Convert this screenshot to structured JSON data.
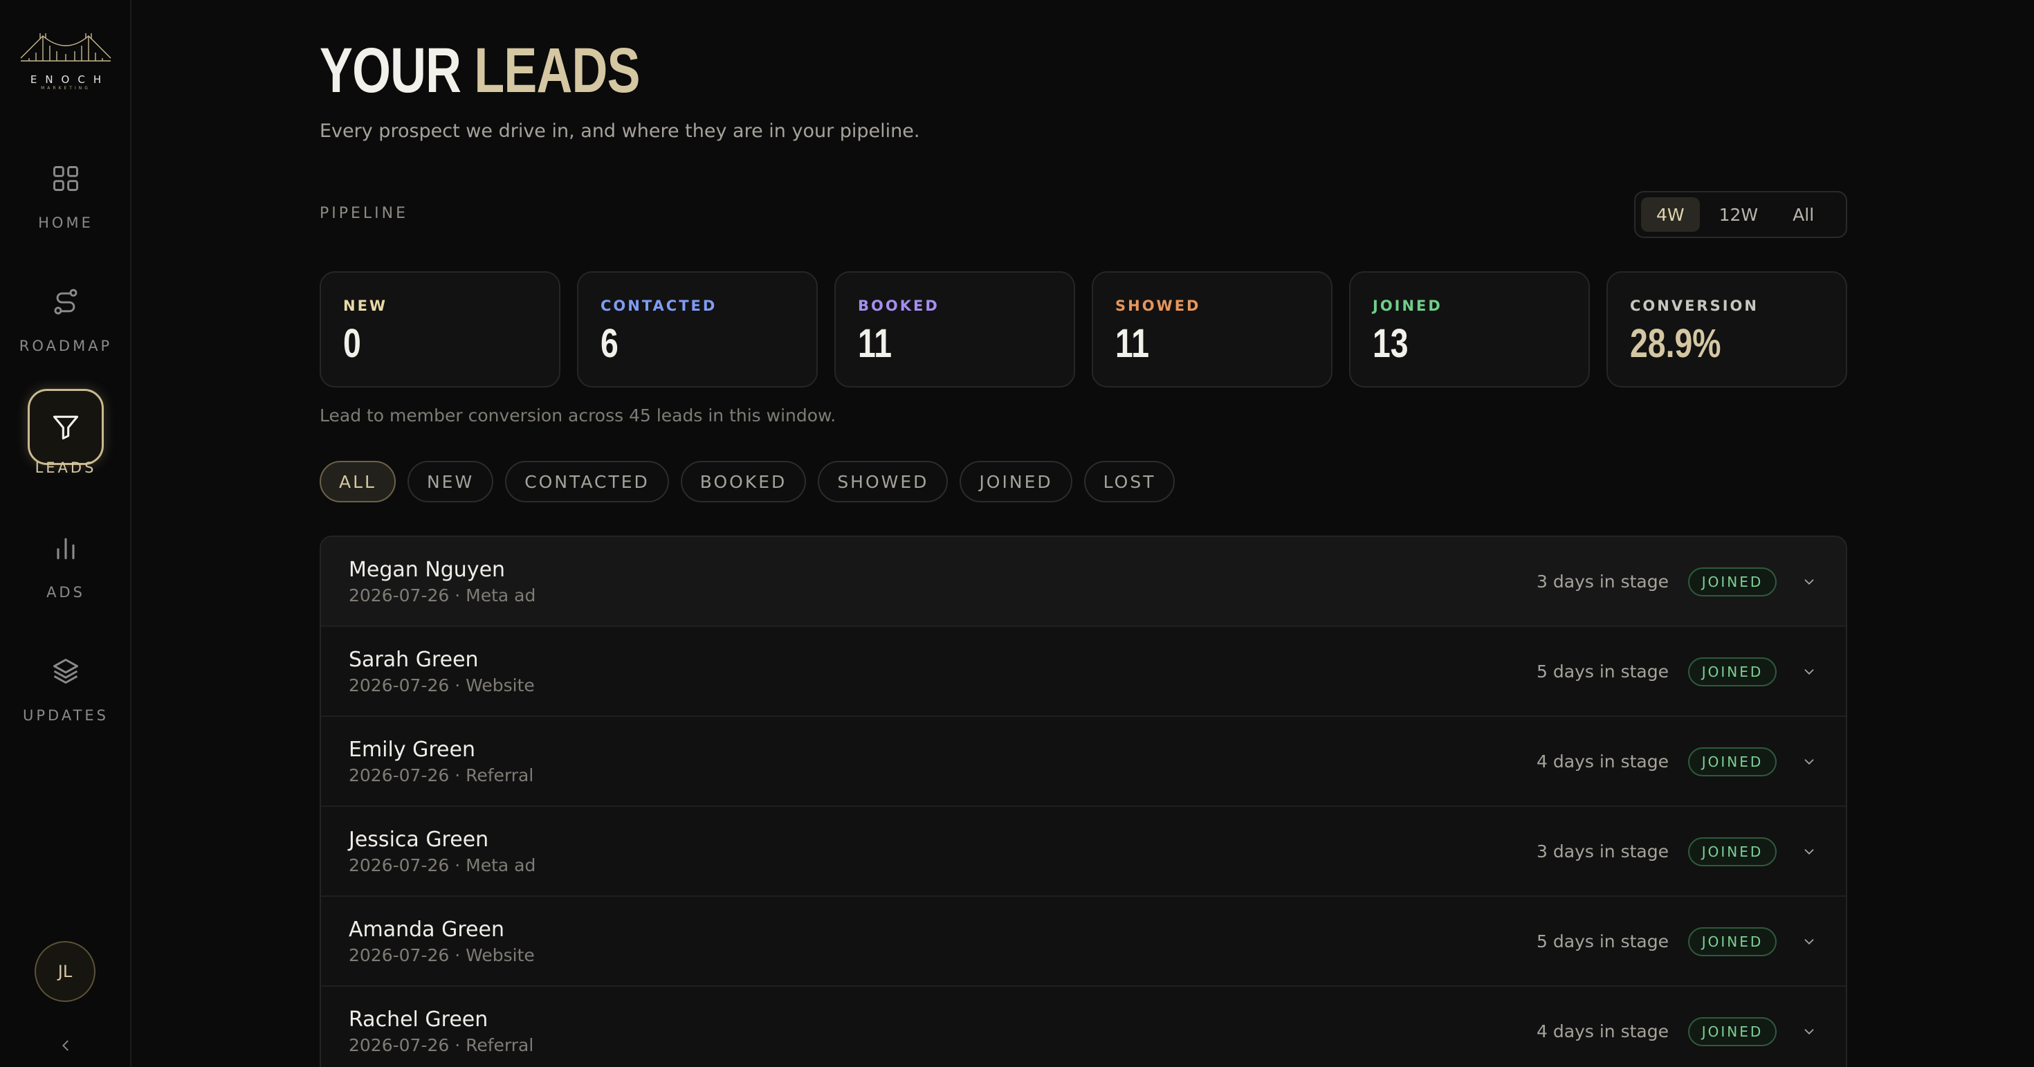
{
  "sidebar": {
    "logo_text": "ENOCH",
    "logo_sub": "MARKETING",
    "items": [
      {
        "label": "HOME",
        "icon": "grid-icon"
      },
      {
        "label": "ROADMAP",
        "icon": "route-icon"
      },
      {
        "label": "LEADS",
        "icon": "funnel-icon",
        "active": true
      },
      {
        "label": "ADS",
        "icon": "bar-chart-icon"
      },
      {
        "label": "UPDATES",
        "icon": "layers-icon"
      }
    ],
    "avatar_initials": "JL",
    "collapse_icon": "chevron-left-icon"
  },
  "header": {
    "title_part1": "YOUR",
    "title_part2": "LEADS",
    "subtitle": "Every prospect we drive in, and where they are in your pipeline."
  },
  "pipeline": {
    "section_label": "PIPELINE",
    "range_options": [
      "4W",
      "12W",
      "All"
    ],
    "range_selected": "4W",
    "cards": [
      {
        "label": "NEW",
        "value": "0",
        "color": "#e9d9a6"
      },
      {
        "label": "CONTACTED",
        "value": "6",
        "color": "#7f9cf5"
      },
      {
        "label": "BOOKED",
        "value": "11",
        "color": "#a48ef0"
      },
      {
        "label": "SHOWED",
        "value": "11",
        "color": "#e8965a"
      },
      {
        "label": "JOINED",
        "value": "13",
        "color": "#6fcf8a"
      },
      {
        "label": "CONVERSION",
        "value": "28.9%",
        "color": "#c8c6c0"
      }
    ],
    "caption": "Lead to member conversion across 45 leads in this window."
  },
  "filters": {
    "options": [
      "ALL",
      "NEW",
      "CONTACTED",
      "BOOKED",
      "SHOWED",
      "JOINED",
      "LOST"
    ],
    "selected": "ALL"
  },
  "leads": [
    {
      "name": "Megan Nguyen",
      "meta": "2026-07-26 · Meta ad",
      "days": "3 days in stage",
      "status": "JOINED"
    },
    {
      "name": "Sarah Green",
      "meta": "2026-07-26 · Website",
      "days": "5 days in stage",
      "status": "JOINED"
    },
    {
      "name": "Emily Green",
      "meta": "2026-07-26 · Referral",
      "days": "4 days in stage",
      "status": "JOINED"
    },
    {
      "name": "Jessica Green",
      "meta": "2026-07-26 · Meta ad",
      "days": "3 days in stage",
      "status": "JOINED"
    },
    {
      "name": "Amanda Green",
      "meta": "2026-07-26 · Website",
      "days": "5 days in stage",
      "status": "JOINED"
    },
    {
      "name": "Rachel Green",
      "meta": "2026-07-26 · Referral",
      "days": "4 days in stage",
      "status": "JOINED"
    }
  ],
  "colors": {
    "accent_gold": "#d4c7a2",
    "joined_green": "#7dd195",
    "background": "#0b0b0b"
  }
}
